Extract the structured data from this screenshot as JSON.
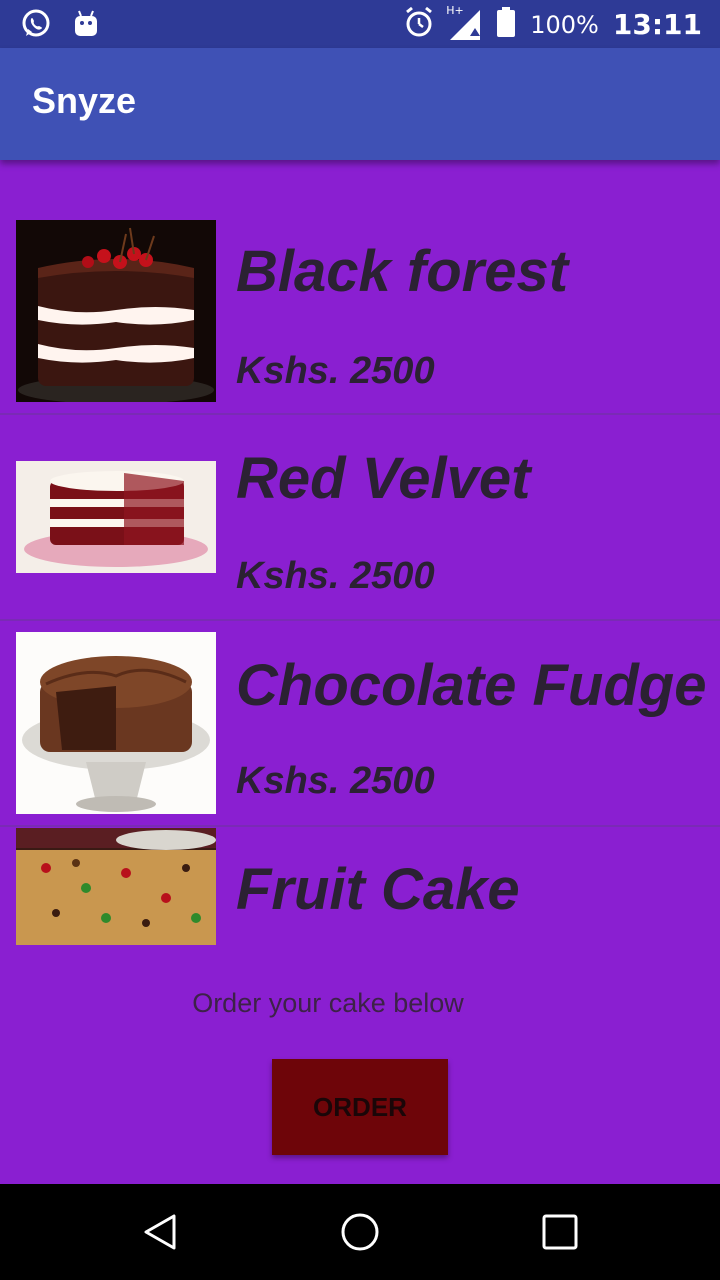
{
  "status_bar": {
    "battery": "100%",
    "time": "13:11",
    "network": "H+"
  },
  "app_bar": {
    "title": "Snyze"
  },
  "cakes": [
    {
      "name": "Black forest",
      "price": "Kshs. 2500",
      "image_icon": "black-forest-cake-image"
    },
    {
      "name": "Red Velvet",
      "price": "Kshs. 2500",
      "image_icon": "red-velvet-cake-image"
    },
    {
      "name": "Chocolate Fudge",
      "price": "Kshs. 2500",
      "image_icon": "chocolate-fudge-cake-image"
    },
    {
      "name": "Fruit Cake",
      "price": "",
      "image_icon": "fruit-cake-image"
    }
  ],
  "order": {
    "prompt": "Order your cake below",
    "button_label": "ORDER"
  },
  "colors": {
    "background": "#8a1fd1",
    "app_bar": "#3f51b5",
    "status_bar": "#2e3a96",
    "order_button": "#6e0509"
  }
}
